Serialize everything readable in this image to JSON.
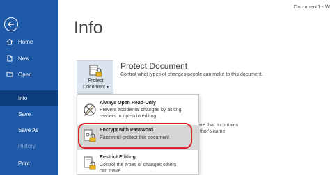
{
  "window": {
    "doc_title": "Document1 - W"
  },
  "sidebar": {
    "items": [
      {
        "label": "Home",
        "icon": "home-icon",
        "active": false
      },
      {
        "label": "New",
        "icon": "new-document-icon",
        "active": false
      },
      {
        "label": "Open",
        "icon": "folder-open-icon",
        "active": false
      },
      {
        "label": "Info",
        "active": true
      },
      {
        "label": "Save",
        "active": false
      },
      {
        "label": "Save As",
        "active": false
      },
      {
        "label": "History",
        "active": false,
        "disabled": true
      },
      {
        "label": "Print",
        "active": false
      }
    ]
  },
  "main": {
    "title": "Info",
    "protect": {
      "tile_line1": "Protect",
      "tile_line2": "Document",
      "heading": "Protect Document",
      "description": "Control what types of changes people can make to this document."
    },
    "background_text": {
      "line1": "are that it contains:",
      "line2": "thor's name"
    }
  },
  "menu": {
    "items": [
      {
        "title": "Always Open Read-Only",
        "desc1": "Prevent accidental changes by asking",
        "desc2": "readers to opt-in to editing.",
        "icon": "no-edit-pencil-icon"
      },
      {
        "title": "Encrypt with Password",
        "desc1": "Password-protect this document",
        "desc2": "",
        "icon": "lock-key-icon",
        "highlighted": true
      },
      {
        "title": "Restrict Editing",
        "desc1": "Control the types of changes others",
        "desc2": "can make",
        "icon": "restrict-lock-icon"
      }
    ]
  },
  "colors": {
    "sidebar": "#1e5aa8",
    "sidebar_active": "#0f3e7f",
    "highlight_oval": "#d8232a"
  }
}
